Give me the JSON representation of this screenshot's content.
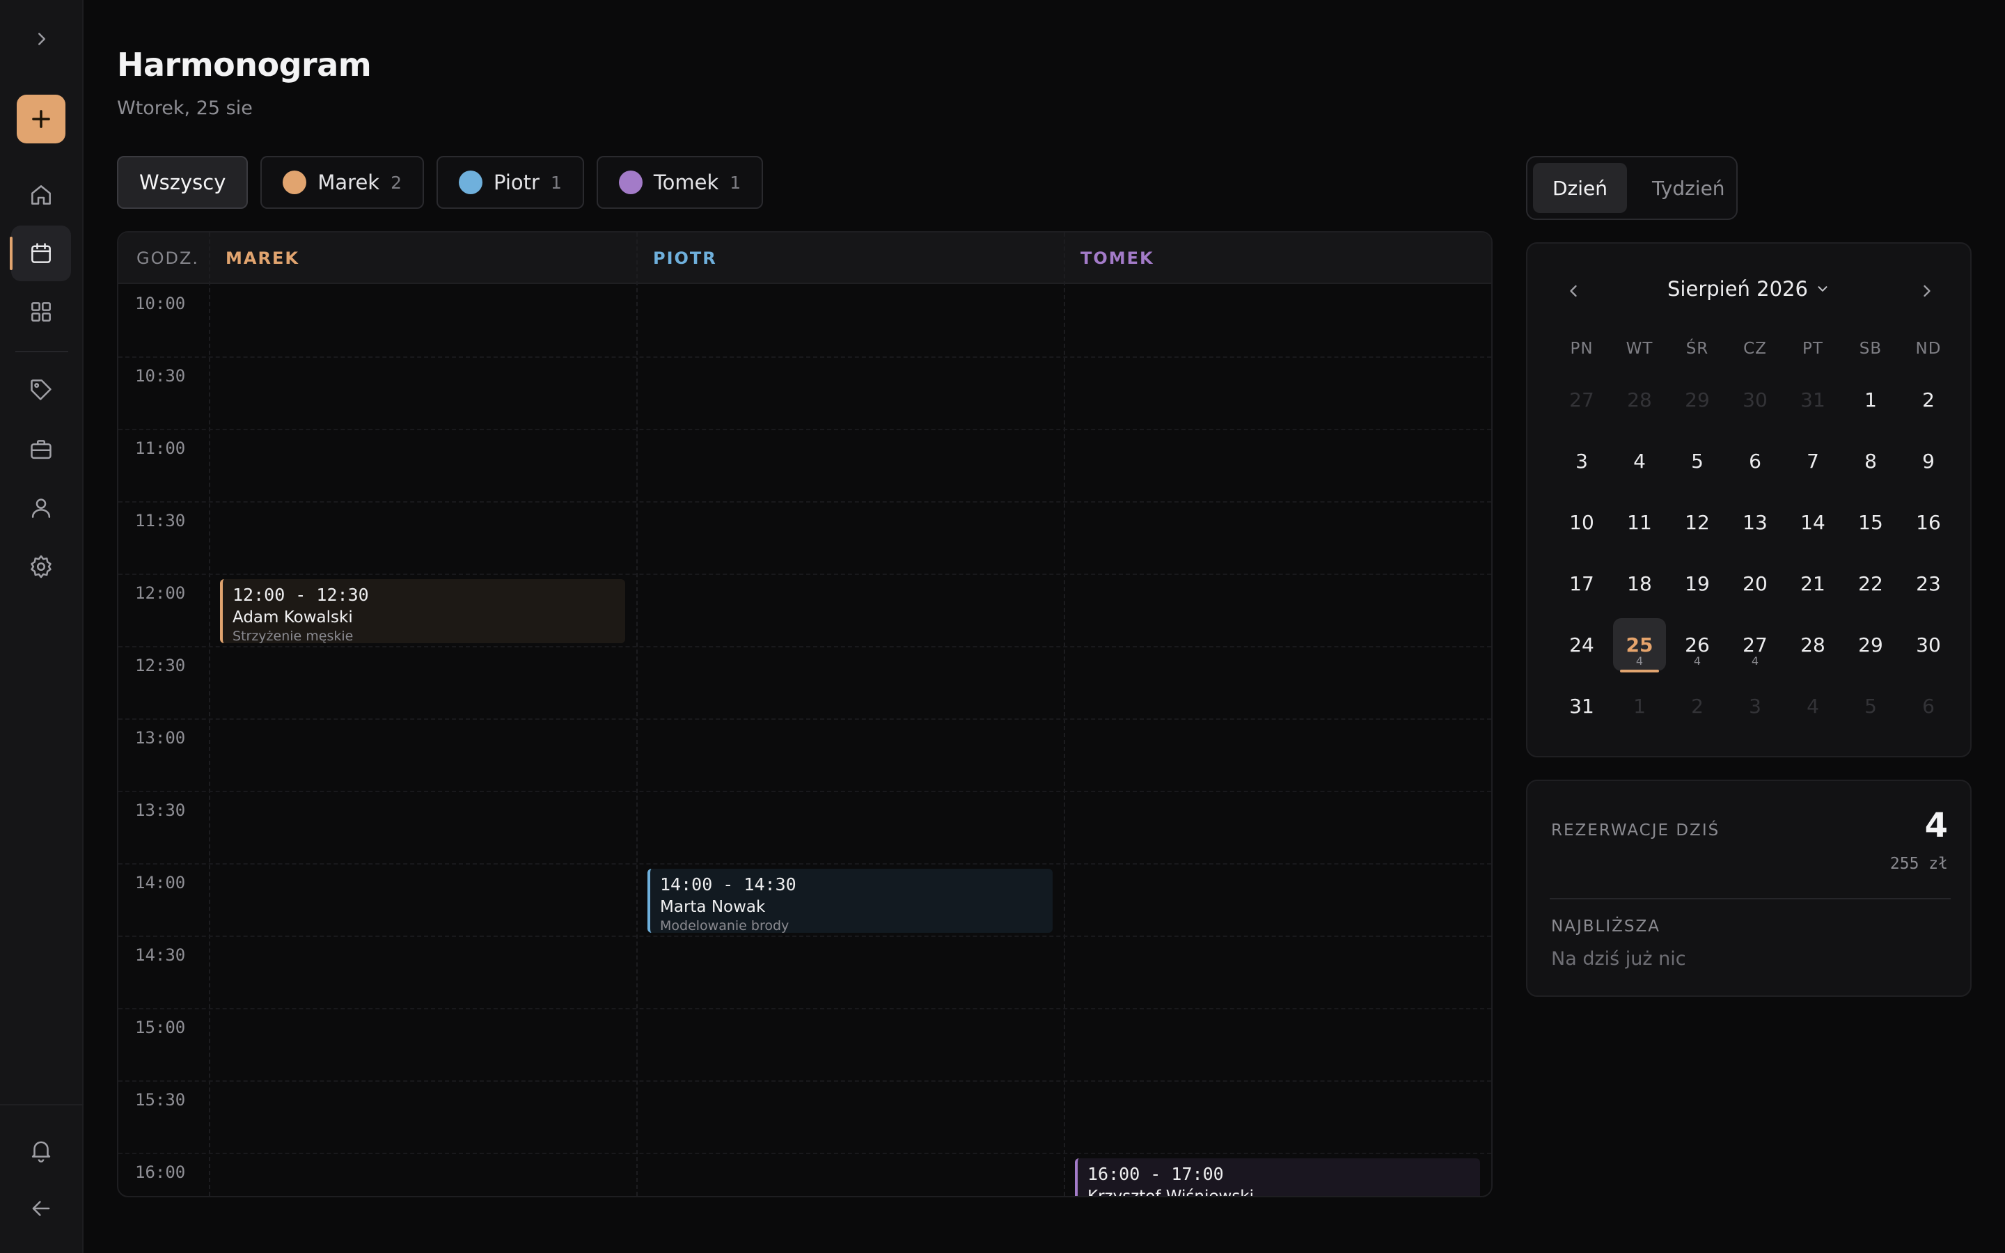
{
  "sidebar": {
    "items": [
      {
        "name": "home-icon"
      },
      {
        "name": "calendar-icon"
      },
      {
        "name": "grid-icon"
      },
      {
        "name": "tag-icon"
      },
      {
        "name": "briefcase-icon"
      },
      {
        "name": "user-icon"
      },
      {
        "name": "gear-icon"
      },
      {
        "name": "bell-icon"
      },
      {
        "name": "arrow-left-icon"
      }
    ],
    "accent": "#e1a46f"
  },
  "header": {
    "title": "Harmonogram",
    "subtitle": "Wtorek, 25 sie"
  },
  "filters": [
    {
      "label": "Wszyscy",
      "count": "",
      "color": ""
    },
    {
      "label": "Marek",
      "count": "2",
      "color": "#e1a46f"
    },
    {
      "label": "Piotr",
      "count": "1",
      "color": "#6fb0dc"
    },
    {
      "label": "Tomek",
      "count": "1",
      "color": "#a37bc8"
    }
  ],
  "schedule": {
    "time_header": "GODZ.",
    "columns": [
      {
        "label": "MAREK",
        "color": "#e1a46f"
      },
      {
        "label": "PIOTR",
        "color": "#6fb0dc"
      },
      {
        "label": "TOMEK",
        "color": "#a37bc8"
      }
    ],
    "times": [
      "10:00",
      "10:30",
      "11:00",
      "11:30",
      "12:00",
      "12:30",
      "13:00",
      "13:30",
      "14:00",
      "14:30",
      "15:00",
      "15:30",
      "16:00"
    ],
    "events": [
      {
        "column": 0,
        "start": "12:00",
        "time": "12:00 - 12:30",
        "client": "Adam Kowalski",
        "service": "Strzyżenie męskie"
      },
      {
        "column": 1,
        "start": "14:00",
        "time": "14:00 - 14:30",
        "client": "Marta Nowak",
        "service": "Modelowanie brody"
      },
      {
        "column": 2,
        "start": "16:00",
        "time": "16:00 - 17:00",
        "client": "Krzysztof Wiśniewski",
        "service": ""
      }
    ]
  },
  "view_toggle": {
    "day": "Dzień",
    "week": "Tydzień"
  },
  "calendar": {
    "month": "Sierpień 2026",
    "weekdays": [
      "PN",
      "WT",
      "ŚR",
      "CZ",
      "PT",
      "SB",
      "ND"
    ],
    "days": [
      {
        "d": "27",
        "muted": true
      },
      {
        "d": "28",
        "muted": true
      },
      {
        "d": "29",
        "muted": true
      },
      {
        "d": "30",
        "muted": true
      },
      {
        "d": "31",
        "muted": true
      },
      {
        "d": "1"
      },
      {
        "d": "2"
      },
      {
        "d": "3"
      },
      {
        "d": "4"
      },
      {
        "d": "5"
      },
      {
        "d": "6"
      },
      {
        "d": "7"
      },
      {
        "d": "8"
      },
      {
        "d": "9"
      },
      {
        "d": "10"
      },
      {
        "d": "11"
      },
      {
        "d": "12"
      },
      {
        "d": "13"
      },
      {
        "d": "14"
      },
      {
        "d": "15"
      },
      {
        "d": "16"
      },
      {
        "d": "17"
      },
      {
        "d": "18"
      },
      {
        "d": "19"
      },
      {
        "d": "20"
      },
      {
        "d": "21"
      },
      {
        "d": "22"
      },
      {
        "d": "23"
      },
      {
        "d": "24"
      },
      {
        "d": "25",
        "today": true,
        "count": "4"
      },
      {
        "d": "26",
        "count": "4"
      },
      {
        "d": "27",
        "count": "4"
      },
      {
        "d": "28"
      },
      {
        "d": "29"
      },
      {
        "d": "30"
      },
      {
        "d": "31"
      },
      {
        "d": "1",
        "muted": true
      },
      {
        "d": "2",
        "muted": true
      },
      {
        "d": "3",
        "muted": true
      },
      {
        "d": "4",
        "muted": true
      },
      {
        "d": "5",
        "muted": true
      },
      {
        "d": "6",
        "muted": true
      }
    ]
  },
  "stats": {
    "today_label": "REZERWACJE DZIŚ",
    "today_count": "4",
    "today_amount": "255 zł",
    "next_label": "NAJBLIŻSZA",
    "next_value": "Na dziś już nic"
  }
}
